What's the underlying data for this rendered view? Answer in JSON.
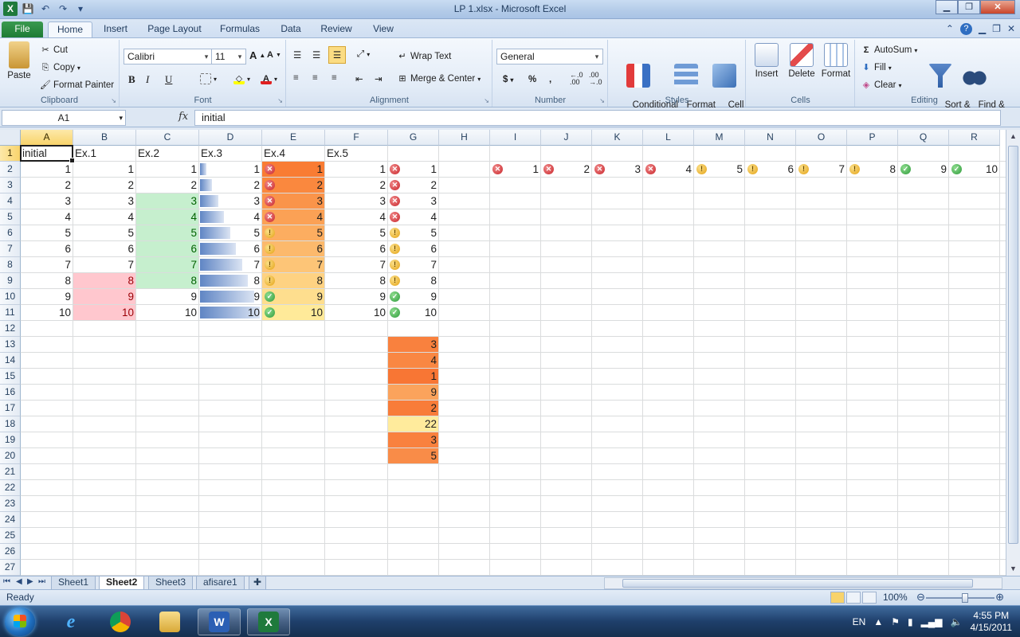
{
  "window": {
    "title": "LP 1.xlsx  -  Microsoft Excel"
  },
  "ribbon_tabs": [
    "File",
    "Home",
    "Insert",
    "Page Layout",
    "Formulas",
    "Data",
    "Review",
    "View"
  ],
  "ribbon": {
    "clipboard": {
      "label": "Clipboard",
      "paste": "Paste",
      "cut": "Cut",
      "copy": "Copy",
      "format_painter": "Format Painter"
    },
    "font": {
      "label": "Font",
      "name": "Calibri",
      "size": "11",
      "bold": "B",
      "italic": "I",
      "underline": "U"
    },
    "alignment": {
      "label": "Alignment",
      "wrap": "Wrap Text",
      "merge": "Merge & Center"
    },
    "number": {
      "label": "Number",
      "format": "General",
      "currency": "$",
      "percent": "%",
      "comma": ",",
      "inc": "←.0\n.00",
      "dec": ".00\n→.0"
    },
    "styles": {
      "label": "Styles",
      "conditional": "Conditional\nFormatting",
      "format_table": "Format\nas Table",
      "cell_styles": "Cell\nStyles"
    },
    "cells": {
      "label": "Cells",
      "insert": "Insert",
      "delete": "Delete",
      "format": "Format"
    },
    "editing": {
      "label": "Editing",
      "autosum": "AutoSum",
      "fill": "Fill",
      "clear": "Clear",
      "sort": "Sort &\nFilter",
      "find": "Find &\nSelect"
    }
  },
  "formula_bar": {
    "name_box": "A1",
    "fx": "fx",
    "content": "initial"
  },
  "columns": [
    "A",
    "B",
    "C",
    "D",
    "E",
    "F",
    "G",
    "H",
    "I",
    "J",
    "K",
    "L",
    "M",
    "N",
    "O",
    "P",
    "Q",
    "R"
  ],
  "rows": [
    "1",
    "2",
    "3",
    "4",
    "5",
    "6",
    "7",
    "8",
    "9",
    "10",
    "11",
    "12",
    "13",
    "14",
    "15",
    "16",
    "17",
    "18",
    "19",
    "20",
    "21",
    "22",
    "23",
    "24",
    "25",
    "26",
    "27"
  ],
  "headers_row1": [
    "initial",
    "Ex.1",
    "Ex.2",
    "Ex.3",
    "Ex.4",
    "Ex.5"
  ],
  "values_1_to_10": [
    "1",
    "2",
    "3",
    "4",
    "5",
    "6",
    "7",
    "8",
    "9",
    "10"
  ],
  "g_values_13_20": [
    "3",
    "4",
    "1",
    "9",
    "2",
    "22",
    "3",
    "5"
  ],
  "row2_i_to_r": [
    "1",
    "2",
    "3",
    "4",
    "5",
    "6",
    "7",
    "8",
    "9",
    "10"
  ],
  "sheets": [
    "Sheet1",
    "Sheet2",
    "Sheet3",
    "afisare1"
  ],
  "active_sheet": "Sheet2",
  "status": {
    "text": "Ready",
    "zoom": "100%"
  },
  "taskbar": {
    "lang": "EN",
    "time": "4:55 PM",
    "date": "4/15/2011"
  },
  "colors": {
    "excel_green": "#1f7a3c",
    "selection_gold": "#f8d36b",
    "red_fill": "#ffc7ce",
    "red_text": "#9c0006",
    "green_fill": "#c6efce",
    "green_text": "#006100"
  }
}
